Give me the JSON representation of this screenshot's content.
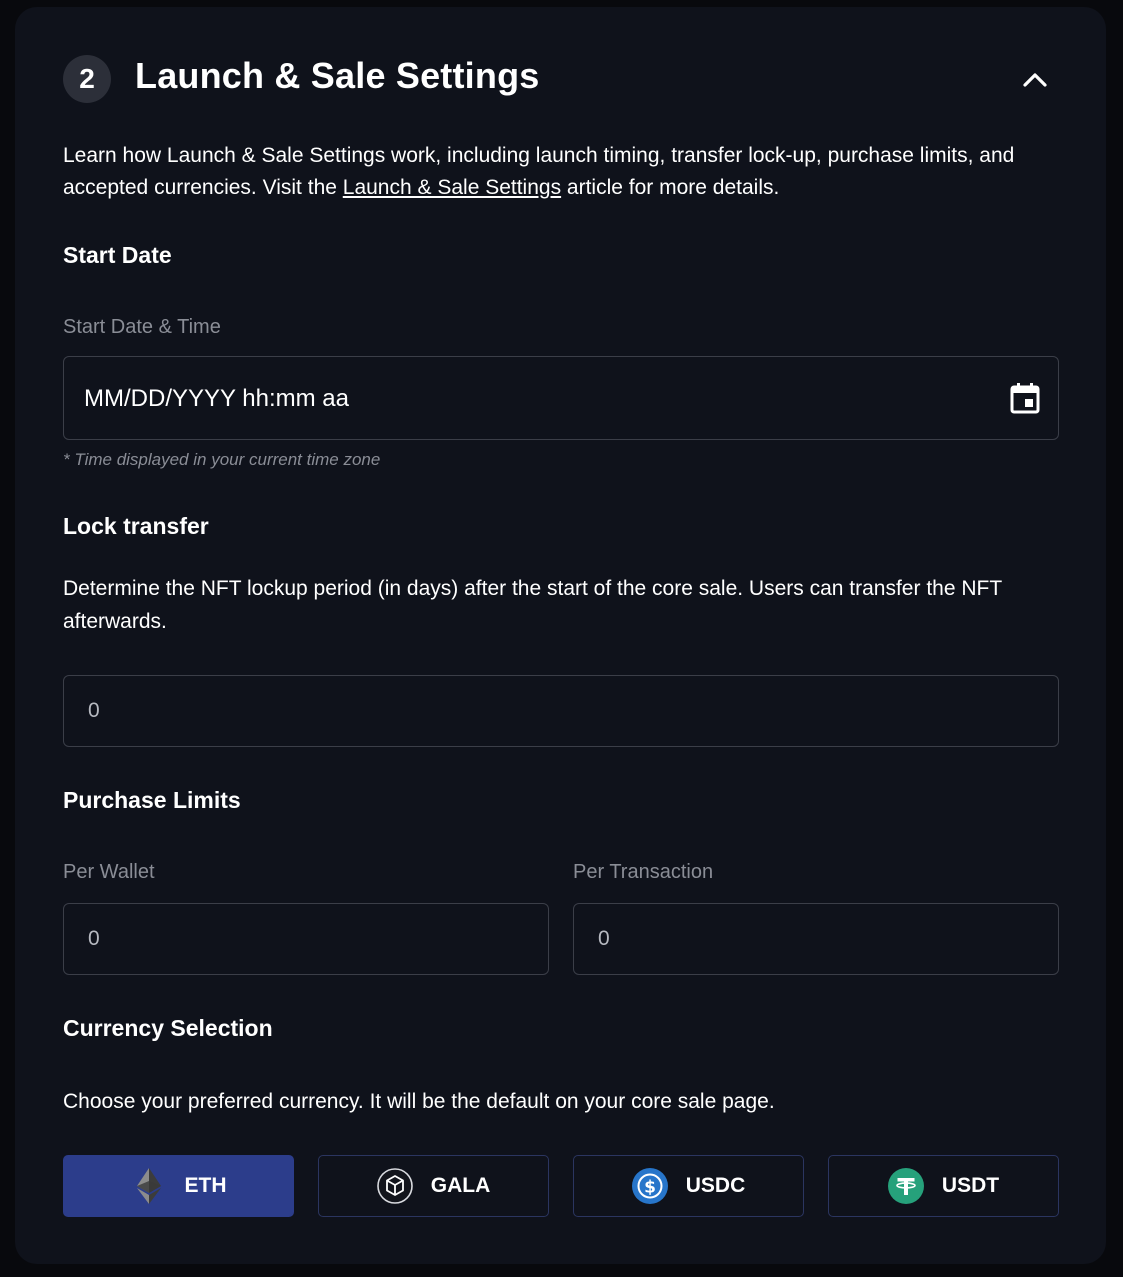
{
  "section": {
    "step": "2",
    "title": "Launch & Sale Settings",
    "intro_before": "Learn how Launch & Sale Settings work, including launch timing, transfer lock-up, purchase limits, and accepted currencies. Visit the ",
    "intro_link": "Launch & Sale Settings",
    "intro_after": " article for more details."
  },
  "start_date": {
    "heading": "Start Date",
    "label": "Start Date & Time",
    "placeholder": "MM/DD/YYYY hh:mm aa",
    "hint": "* Time displayed in your current time zone",
    "icon": "calendar-icon"
  },
  "lock_transfer": {
    "heading": "Lock transfer",
    "description": "Determine the NFT lockup period (in days) after the start of the core sale. Users can transfer the NFT afterwards.",
    "value": "0"
  },
  "purchase_limits": {
    "heading": "Purchase Limits",
    "per_wallet_label": "Per Wallet",
    "per_wallet_value": "0",
    "per_transaction_label": "Per Transaction",
    "per_transaction_value": "0"
  },
  "currency": {
    "heading": "Currency Selection",
    "description": "Choose your preferred currency. It will be the default on your core sale page.",
    "options": [
      {
        "label": "ETH",
        "icon": "eth-icon",
        "selected": true
      },
      {
        "label": "GALA",
        "icon": "gala-icon",
        "selected": false
      },
      {
        "label": "USDC",
        "icon": "usdc-icon",
        "selected": false
      },
      {
        "label": "USDT",
        "icon": "usdt-icon",
        "selected": false
      }
    ]
  },
  "colors": {
    "background": "#0f121b",
    "selected_currency": "#2c3d8b",
    "usdc": "#2775ca",
    "usdt": "#26a17b"
  }
}
